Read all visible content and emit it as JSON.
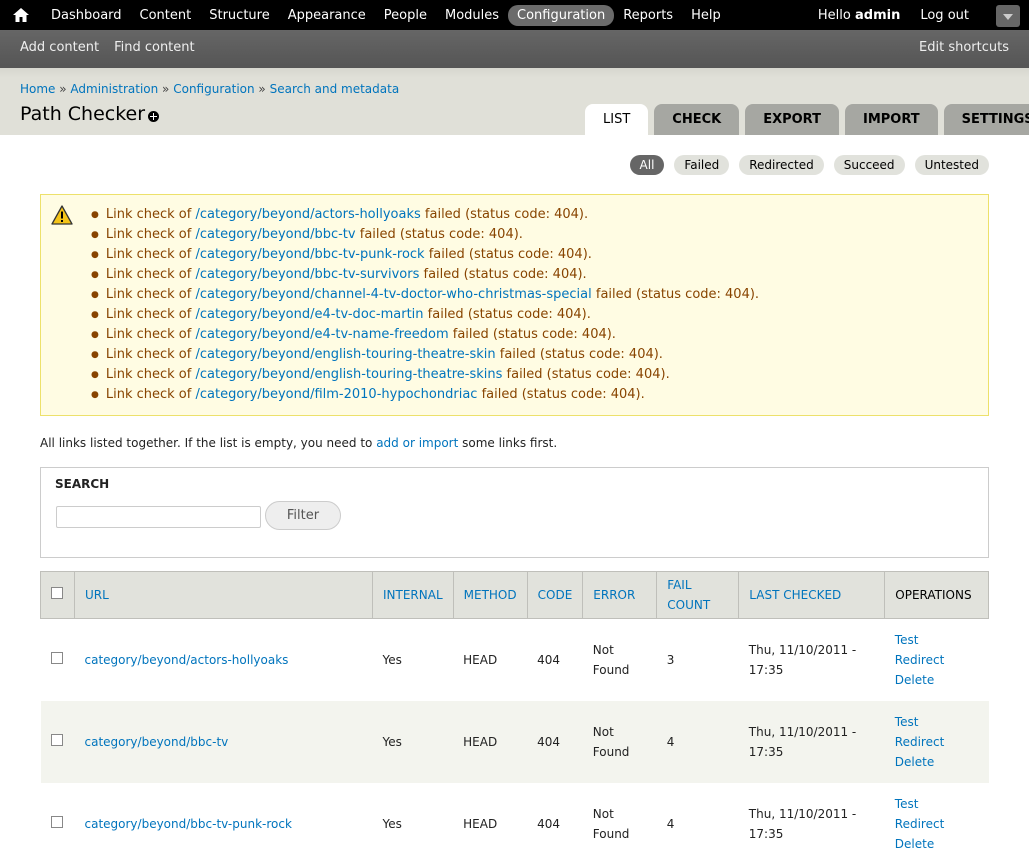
{
  "toolbar": {
    "menu": [
      "Dashboard",
      "Content",
      "Structure",
      "Appearance",
      "People",
      "Modules",
      "Configuration",
      "Reports",
      "Help"
    ],
    "active_item": "Configuration",
    "hello_prefix": "Hello ",
    "username": "admin",
    "logout": "Log out"
  },
  "shortcuts": {
    "items": [
      "Add content",
      "Find content"
    ],
    "edit": "Edit shortcuts"
  },
  "breadcrumb": [
    "Home",
    "Administration",
    "Configuration",
    "Search and metadata"
  ],
  "breadcrumb_sep": " » ",
  "page_title": "Path Checker",
  "tabs": [
    "LIST",
    "CHECK",
    "EXPORT",
    "IMPORT",
    "SETTINGS"
  ],
  "active_tab": "LIST",
  "filters": [
    "All",
    "Failed",
    "Redirected",
    "Succeed",
    "Untested"
  ],
  "active_filter": "All",
  "messages": {
    "prefix": "Link check of ",
    "base": "/category/beyond/",
    "suffix": " failed (status code: 404).",
    "slugs": [
      "actors-hollyoaks",
      "bbc-tv",
      "bbc-tv-punk-rock",
      "bbc-tv-survivors",
      "channel-4-tv-doctor-who-christmas-special",
      "e4-tv-doc-martin",
      "e4-tv-name-freedom",
      "english-touring-theatre-skin",
      "english-touring-theatre-skins",
      "film-2010-hypochondriac"
    ]
  },
  "help": {
    "before": "All links listed together. If the list is empty, you need to ",
    "link": "add or import",
    "after": " some links first."
  },
  "search": {
    "legend": "SEARCH",
    "input_value": "",
    "button": "Filter"
  },
  "table": {
    "headers": {
      "url": "URL",
      "internal": "INTERNAL",
      "method": "METHOD",
      "code": "CODE",
      "error": "ERROR",
      "fail_count_1": "FAIL",
      "fail_count_2": "COUNT",
      "last_checked": "LAST CHECKED",
      "operations": "OPERATIONS"
    },
    "ops": [
      "Test",
      "Redirect",
      "Delete"
    ],
    "rows": [
      {
        "url": "category/beyond/actors-hollyoaks",
        "internal": "Yes",
        "method": "HEAD",
        "code": "404",
        "error_1": "Not",
        "error_2": "Found",
        "fail_count": "3",
        "date_1": "Thu, 11/10/2011 -",
        "date_2": "17:35"
      },
      {
        "url": "category/beyond/bbc-tv",
        "internal": "Yes",
        "method": "HEAD",
        "code": "404",
        "error_1": "Not",
        "error_2": "Found",
        "fail_count": "4",
        "date_1": "Thu, 11/10/2011 -",
        "date_2": "17:35"
      },
      {
        "url": "category/beyond/bbc-tv-punk-rock",
        "internal": "Yes",
        "method": "HEAD",
        "code": "404",
        "error_1": "Not",
        "error_2": "Found",
        "fail_count": "4",
        "date_1": "Thu, 11/10/2011 -",
        "date_2": "17:35"
      }
    ]
  },
  "colors": {
    "link": "#0074bd",
    "warning_bg": "#fffce3",
    "warning_text": "#884400",
    "toolbar_bg": "#000000"
  }
}
